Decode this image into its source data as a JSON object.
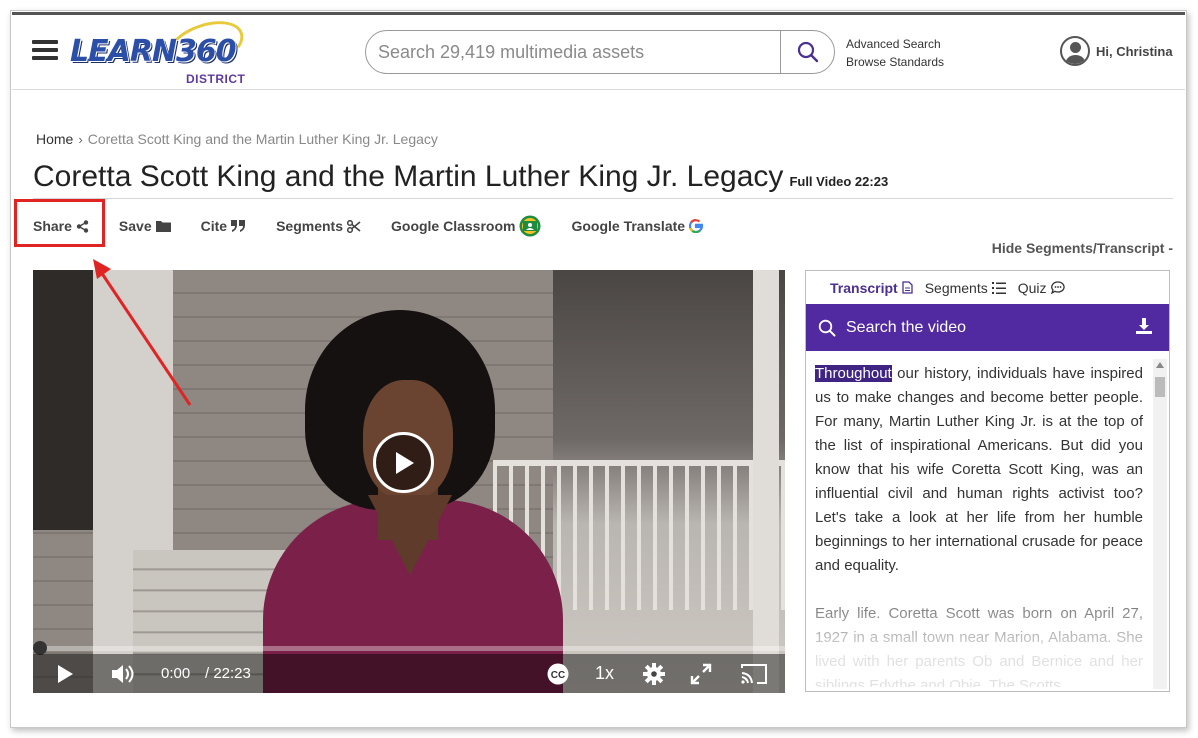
{
  "header": {
    "logo_main": "LEARN360",
    "logo_sub": "DISTRICT",
    "search_placeholder": "Search 29,419 multimedia assets",
    "advanced_search": "Advanced Search",
    "browse_standards": "Browse Standards",
    "user_greeting": "Hi, Christina"
  },
  "breadcrumb": {
    "home": "Home",
    "separator": "›",
    "current": "Coretta Scott King and the Martin Luther King Jr. Legacy"
  },
  "page": {
    "title": "Coretta Scott King and the Martin Luther King Jr. Legacy",
    "meta": "Full Video 22:23"
  },
  "toolbar": {
    "share": "Share",
    "save": "Save",
    "cite": "Cite",
    "segments": "Segments",
    "google_classroom": "Google Classroom",
    "google_translate": "Google Translate"
  },
  "hide_segments": "Hide Segments/Transcript -",
  "player": {
    "current_time": "0:00",
    "duration": "/ 22:23",
    "speed": "1x",
    "cc_label": "CC",
    "progress_fraction": 0
  },
  "panel": {
    "tabs": [
      {
        "label": "Transcript",
        "icon": "document-icon",
        "active": true
      },
      {
        "label": "Segments",
        "icon": "list-icon",
        "active": false
      },
      {
        "label": "Quiz",
        "icon": "chat-icon",
        "active": false
      }
    ],
    "search_label": "Search the video",
    "transcript_highlight": "Throughout",
    "transcript_p1_rest": " our history, individuals have inspired us to make changes and become better people. For many, Martin Luther King Jr. is at the top of the list of inspirational Americans. But did you know that his wife Coretta Scott King, was an influential civil and human rights activist too? Let's take a look at her life from her humble beginnings to her international crusade for peace and equality.",
    "transcript_p2": "Early life. Coretta Scott was born on April 27, 1927 in a small town near Marion, Alabama. She lived with her parents Ob and Bernice and her siblings Edythe and Obie. The Scotts"
  },
  "colors": {
    "accent_purple": "#5129a0",
    "highlight_red": "#e02424",
    "brand_blue": "#2b4fa8"
  }
}
